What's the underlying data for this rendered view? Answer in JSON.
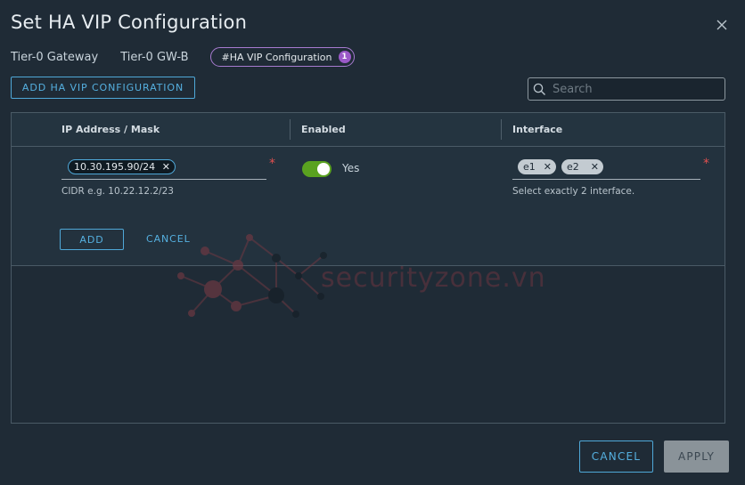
{
  "dialog": {
    "title": "Set HA VIP Configuration"
  },
  "breadcrumb": {
    "items": [
      "Tier-0 Gateway",
      "Tier-0 GW-B"
    ],
    "current": "#HA VIP Configuration",
    "current_count": "1"
  },
  "toolbar": {
    "add_label": "ADD HA VIP CONFIGURATION",
    "search_placeholder": "Search"
  },
  "grid": {
    "columns": [
      "IP Address / Mask",
      "Enabled",
      "Interface"
    ],
    "edit_row": {
      "ip_chip": "10.30.195.90/24",
      "ip_hint": "CIDR e.g. 10.22.12.2/23",
      "enabled": true,
      "enabled_label": "Yes",
      "interfaces": [
        "e1",
        "e2"
      ],
      "interface_hint": "Select exactly 2 interface.",
      "required_mark": "*",
      "add_label": "ADD",
      "cancel_label": "CANCEL"
    }
  },
  "footer": {
    "cancel_label": "CANCEL",
    "apply_label": "APPLY"
  },
  "watermark": {
    "text": "securityzone.vn"
  },
  "colors": {
    "accent": "#55b0e0",
    "toggle_on": "#5aa220",
    "badge": "#9b59c8",
    "required": "#e05050"
  }
}
